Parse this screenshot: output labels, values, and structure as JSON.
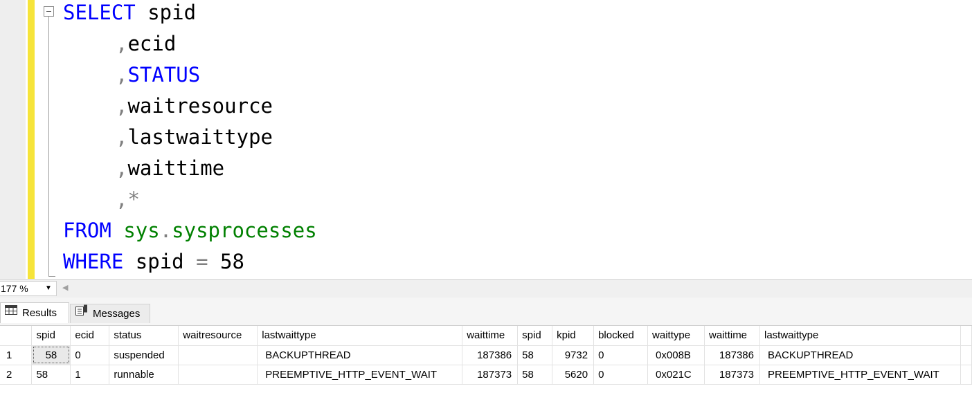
{
  "editor": {
    "lines": [
      {
        "parts": [
          {
            "t": "SELECT",
            "c": "kw"
          },
          {
            "t": " spid",
            "c": ""
          }
        ]
      },
      {
        "parts": [
          {
            "t": ",",
            "c": "punct"
          },
          {
            "t": "ecid",
            "c": ""
          }
        ],
        "indent": true
      },
      {
        "parts": [
          {
            "t": ",",
            "c": "punct"
          },
          {
            "t": "STATUS",
            "c": "kw"
          }
        ],
        "indent": true
      },
      {
        "parts": [
          {
            "t": ",",
            "c": "punct"
          },
          {
            "t": "waitresource",
            "c": ""
          }
        ],
        "indent": true
      },
      {
        "parts": [
          {
            "t": ",",
            "c": "punct"
          },
          {
            "t": "lastwaittype",
            "c": ""
          }
        ],
        "indent": true
      },
      {
        "parts": [
          {
            "t": ",",
            "c": "punct"
          },
          {
            "t": "waittime",
            "c": ""
          }
        ],
        "indent": true
      },
      {
        "parts": [
          {
            "t": ",",
            "c": "punct"
          },
          {
            "t": "*",
            "c": "punct"
          }
        ],
        "indent": true
      },
      {
        "parts": [
          {
            "t": "FROM",
            "c": "kw"
          },
          {
            "t": " ",
            "c": ""
          },
          {
            "t": "sys",
            "c": "obj"
          },
          {
            "t": ".",
            "c": "punct"
          },
          {
            "t": "sysprocesses",
            "c": "obj"
          }
        ]
      },
      {
        "parts": [
          {
            "t": "WHERE",
            "c": "kw"
          },
          {
            "t": " spid ",
            "c": ""
          },
          {
            "t": "=",
            "c": "punct"
          },
          {
            "t": " 58",
            "c": ""
          }
        ]
      }
    ]
  },
  "zoom": {
    "value": "177 %"
  },
  "tabs": {
    "results": "Results",
    "messages": "Messages"
  },
  "grid": {
    "columns": [
      "",
      "spid",
      "ecid",
      "status",
      "waitresource",
      "lastwaittype",
      "waittime",
      "spid",
      "kpid",
      "blocked",
      "waittype",
      "waittime",
      "lastwaittype",
      ""
    ],
    "rows": [
      [
        "1",
        "58",
        "0",
        "suspended",
        "",
        "BACKUPTHREAD",
        "187386",
        "58",
        "9732",
        "0",
        "0x008B",
        "187386",
        "BACKUPTHREAD",
        ""
      ],
      [
        "2",
        "58",
        "1",
        "runnable",
        "",
        "PREEMPTIVE_HTTP_EVENT_WAIT",
        "187373",
        "58",
        "5620",
        "0",
        "0x021C",
        "187373",
        "PREEMPTIVE_HTTP_EVENT_WAIT",
        ""
      ]
    ]
  },
  "colors": {
    "keyword": "#0000ff",
    "object": "#008000",
    "operator": "#808080",
    "change_bar": "#f6e43a"
  }
}
